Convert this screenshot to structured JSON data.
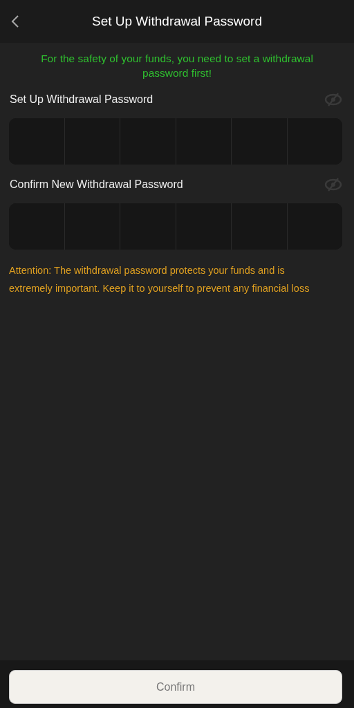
{
  "header": {
    "title": "Set Up Withdrawal Password"
  },
  "notice": "For the safety of your funds, you need to set a withdrawal password first!",
  "password_fields": [
    {
      "label": "Set Up Withdrawal Password",
      "visible": false
    },
    {
      "label": "Confirm New Withdrawal Password",
      "visible": false
    }
  ],
  "attention": "Attention: The withdrawal password protects your funds and is extremely important. Keep it to yourself to prevent any financial loss",
  "confirm_button": {
    "label": "Confirm",
    "disabled": true
  }
}
